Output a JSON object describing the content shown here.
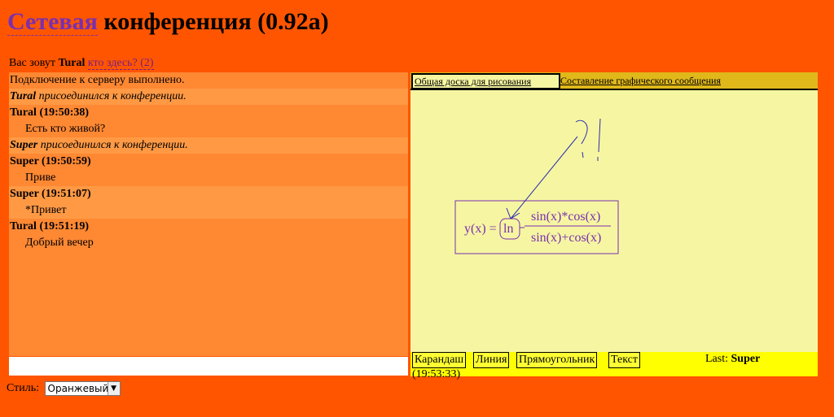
{
  "header": {
    "title_highlight": "Сетевая",
    "title_rest": " конференция (0.92а)"
  },
  "user": {
    "prefix": "Вас зовут ",
    "name": "Tural",
    "who_link": "кто здесь? (2)"
  },
  "chat": {
    "rows": [
      {
        "type": "system",
        "text": "Подключение к серверу выполнено."
      },
      {
        "type": "join",
        "name": "Tural",
        "text": " присоединился к конференции."
      },
      {
        "type": "header",
        "text": "Tural (19:50:38)"
      },
      {
        "type": "message",
        "text": "Есть кто живой?"
      },
      {
        "type": "join",
        "name": "Super",
        "text": " присоединился к конференции."
      },
      {
        "type": "header",
        "text": "Super (19:50:59)"
      },
      {
        "type": "message",
        "text": "Приве"
      },
      {
        "type": "header",
        "text": "Super (19:51:07)"
      },
      {
        "type": "message",
        "text": "*Привет"
      },
      {
        "type": "header",
        "text": "Tural (19:51:19)"
      },
      {
        "type": "message",
        "text": "Добрый вечер"
      }
    ],
    "input_value": ""
  },
  "board": {
    "tabs": [
      {
        "label": "Общая доска для рисования",
        "active": true
      },
      {
        "label": "Составление графического сообщения",
        "active": false
      }
    ],
    "formula": {
      "lhs": "y(x) =",
      "fn": "ln",
      "numerator": "sin(x)*cos(x)",
      "denominator": "sin(x)+cos(x)"
    },
    "tools": [
      "Карандаш",
      "Линия",
      "Прямоугольник",
      "Текст"
    ],
    "last_label": "Last: ",
    "last_user": "Super",
    "last_time": "(19:53:33)"
  },
  "style": {
    "label": "Стиль:",
    "selected": "Оранжевый"
  },
  "colors": {
    "page_bg": "#ff5500",
    "chat_bg": "#ff8833",
    "chat_row_alt": "#ff9944",
    "board_bg": "#f6f6a2",
    "tabs_bg": "#e0b81a",
    "toolbar_bg": "#ffff00",
    "drawing_color": "#7a2fb0",
    "arrow_color": "#2a2ab0"
  }
}
